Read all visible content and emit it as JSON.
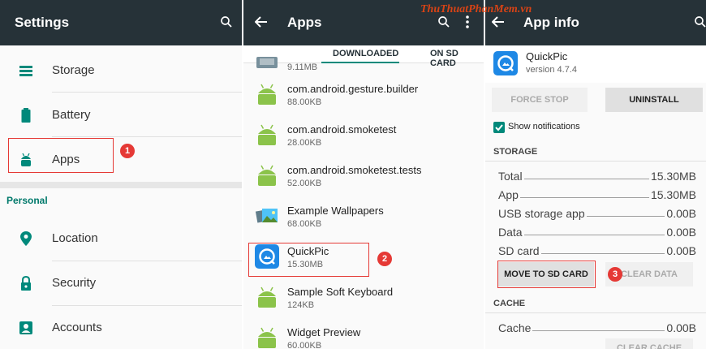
{
  "settings": {
    "title": "Settings",
    "items_top": [
      {
        "label": "Storage",
        "icon": "storage-icon"
      },
      {
        "label": "Battery",
        "icon": "battery-icon"
      },
      {
        "label": "Apps",
        "icon": "android-icon"
      }
    ],
    "section": "Personal",
    "items_personal": [
      {
        "label": "Location",
        "icon": "location-icon"
      },
      {
        "label": "Security",
        "icon": "lock-icon"
      },
      {
        "label": "Accounts",
        "icon": "account-icon"
      }
    ]
  },
  "apps": {
    "title": "Apps",
    "tabs": [
      "DOWNLOADED",
      "ON SD CARD"
    ],
    "list": [
      {
        "name": "",
        "size": "9.11MB"
      },
      {
        "name": "com.android.gesture.builder",
        "size": "88.00KB"
      },
      {
        "name": "com.android.smoketest",
        "size": "28.00KB"
      },
      {
        "name": "com.android.smoketest.tests",
        "size": "52.00KB"
      },
      {
        "name": "Example Wallpapers",
        "size": "68.00KB"
      },
      {
        "name": "QuickPic",
        "size": "15.30MB"
      },
      {
        "name": "Sample Soft Keyboard",
        "size": "124KB"
      },
      {
        "name": "Widget Preview",
        "size": "60.00KB"
      }
    ]
  },
  "app_info": {
    "title": "App info",
    "brand": "ThuThuatPhanMem.vn",
    "app_name": "QuickPic",
    "version": "version 4.7.4",
    "force_stop": "FORCE STOP",
    "uninstall": "UNINSTALL",
    "show_notifications": "Show notifications",
    "storage_header": "STORAGE",
    "storage": [
      {
        "k": "Total",
        "v": "15.30MB"
      },
      {
        "k": "App",
        "v": "15.30MB"
      },
      {
        "k": "USB storage app",
        "v": "0.00B"
      },
      {
        "k": "Data",
        "v": "0.00B"
      },
      {
        "k": "SD card",
        "v": "0.00B"
      }
    ],
    "move_sd": "MOVE TO SD CARD",
    "clear_data": "CLEAR DATA",
    "cache_header": "CACHE",
    "cache": {
      "k": "Cache",
      "v": "0.00B"
    },
    "clear_cache": "CLEAR CACHE"
  },
  "callouts": [
    "1",
    "2",
    "3"
  ],
  "colors": {
    "toolbar": "#263238",
    "accent": "#00897b",
    "callout": "#e53935"
  }
}
